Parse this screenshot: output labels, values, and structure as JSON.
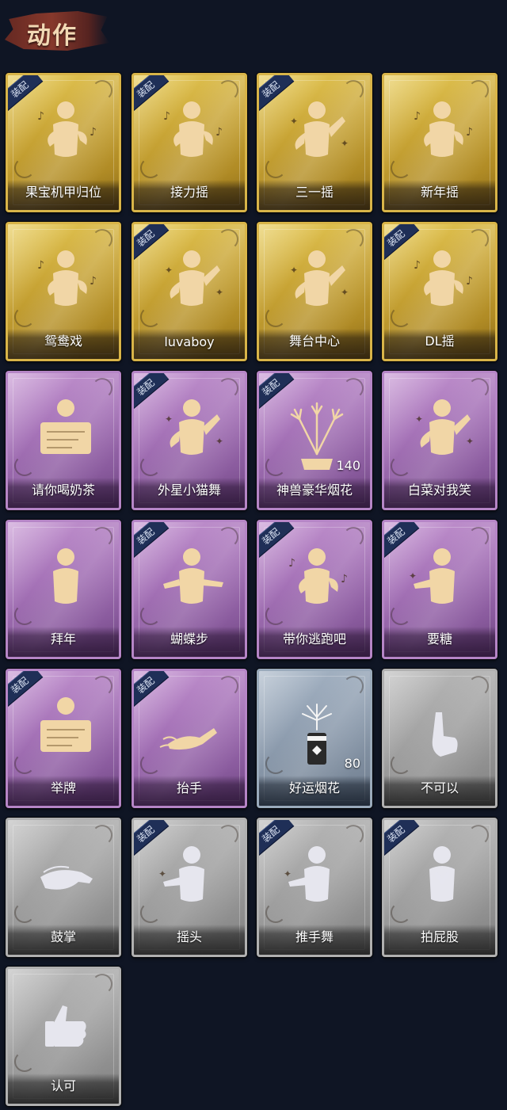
{
  "header": {
    "title": "动作"
  },
  "cards": [
    {
      "label": "果宝机甲归位",
      "tier": "gold",
      "equipped": true,
      "icon": "figure-music-icon"
    },
    {
      "label": "接力摇",
      "tier": "gold",
      "equipped": true,
      "icon": "figure-music-icon"
    },
    {
      "label": "三一摇",
      "tier": "gold",
      "equipped": true,
      "icon": "figure-sparkle-icon"
    },
    {
      "label": "新年摇",
      "tier": "gold",
      "equipped": false,
      "icon": "figure-music-icon"
    },
    {
      "label": "鸳鸯戏",
      "tier": "gold",
      "equipped": false,
      "icon": "figure-music-icon"
    },
    {
      "label": "luvaboy",
      "tier": "gold",
      "equipped": true,
      "icon": "figure-sparkle-icon"
    },
    {
      "label": "舞台中心",
      "tier": "gold",
      "equipped": false,
      "icon": "figure-sparkle-icon"
    },
    {
      "label": "DL摇",
      "tier": "gold",
      "equipped": true,
      "icon": "figure-music-icon"
    },
    {
      "label": "请你喝奶茶",
      "tier": "purple",
      "equipped": false,
      "icon": "figure-sign-icon"
    },
    {
      "label": "外星小猫舞",
      "tier": "purple",
      "equipped": true,
      "icon": "figure-sparkle-icon"
    },
    {
      "label": "神兽豪华烟花",
      "tier": "purple",
      "equipped": true,
      "icon": "firework-icon",
      "count": "140"
    },
    {
      "label": "白菜对我笑",
      "tier": "purple",
      "equipped": false,
      "icon": "figure-sparkle-icon"
    },
    {
      "label": "拜年",
      "tier": "purple",
      "equipped": false,
      "icon": "figure-bow-icon"
    },
    {
      "label": "蝴蝶步",
      "tier": "purple",
      "equipped": true,
      "icon": "figure-point-icon"
    },
    {
      "label": "带你逃跑吧",
      "tier": "purple",
      "equipped": true,
      "icon": "figure-music-icon"
    },
    {
      "label": "要糖",
      "tier": "purple",
      "equipped": true,
      "icon": "figure-reach-icon"
    },
    {
      "label": "举牌",
      "tier": "purple",
      "equipped": true,
      "icon": "figure-sign-icon"
    },
    {
      "label": "抬手",
      "tier": "purple",
      "equipped": true,
      "icon": "hand-raise-icon"
    },
    {
      "label": "好运烟花",
      "tier": "blue",
      "equipped": false,
      "icon": "firework-can-icon",
      "count": "80"
    },
    {
      "label": "不可以",
      "tier": "gray",
      "equipped": false,
      "icon": "finger-wag-icon"
    },
    {
      "label": "鼓掌",
      "tier": "gray",
      "equipped": false,
      "icon": "clap-icon"
    },
    {
      "label": "摇头",
      "tier": "gray",
      "equipped": true,
      "icon": "figure-reach-icon"
    },
    {
      "label": "推手舞",
      "tier": "gray",
      "equipped": true,
      "icon": "figure-reach-icon"
    },
    {
      "label": "拍屁股",
      "tier": "gray",
      "equipped": true,
      "icon": "figure-bow-icon"
    },
    {
      "label": "认可",
      "tier": "gray",
      "equipped": false,
      "icon": "thumbs-up-icon"
    }
  ],
  "equipped_tag": "装配",
  "colors": {
    "background": "#0f1524",
    "gold": "#c9a535",
    "purple": "#a673b8",
    "blue": "#8d9cae",
    "gray": "#a2a2a2",
    "tag": "#1f2f57"
  }
}
